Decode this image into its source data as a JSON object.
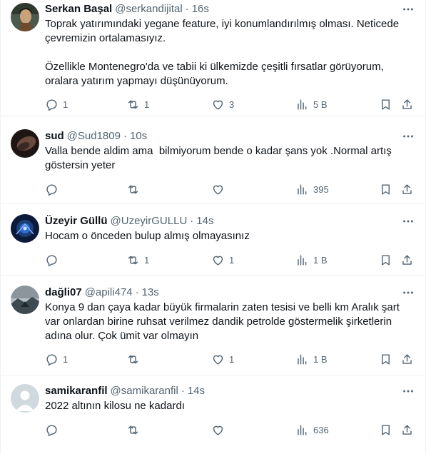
{
  "tweets": [
    {
      "name": "Serkan Başal",
      "handle": "@serkandijital",
      "time": "16s",
      "text": "Toprak yatırımındaki yegane feature, iyi konumlandırılmış olması. Neticede\nçevremizin ortalamasıyız.\n\nÖzellikle Montenegro'da ve tabii ki ülkemizde çeşitli fırsatlar görüyorum,\noralara yatırım yapmayı düşünüyorum.",
      "replies": "1",
      "reposts": "1",
      "likes": "3",
      "views": "5 B",
      "avatar_colors": [
        "#3a4a3c",
        "#c9a27a"
      ]
    },
    {
      "name": "sud",
      "handle": "@Sud1809",
      "time": "10s",
      "text": "Valla bende aldim ama  bilmiyorum bende o kadar şans yok .Normal artış\ngöstersin yeter",
      "replies": "",
      "reposts": "",
      "likes": "",
      "views": "395",
      "avatar_colors": [
        "#1d1614",
        "#6b4a40"
      ]
    },
    {
      "name": "Üzeyir Güllü",
      "handle": "@UzeyirGULLU",
      "time": "14s",
      "text": "Hocam o önceden bulup almış olmayasınız",
      "replies": "",
      "reposts": "1",
      "likes": "1",
      "views": "1 B",
      "avatar_colors": [
        "#0c1a3a",
        "#2d6fd0"
      ]
    },
    {
      "name": "dağli07",
      "handle": "@apili474",
      "time": "13s",
      "text": "Konya 9 dan çaya kadar büyük firmalarin zaten tesisi ve belli km Aralık şart\nvar onlardan birine ruhsat verilmez dandik petrolde göstermelik şirketlerin\nadına olur. Çok ümit var olmayın",
      "replies": "1",
      "reposts": "",
      "likes": "1",
      "views": "1 B",
      "avatar_colors": [
        "#8c959c",
        "#3d4a52"
      ]
    },
    {
      "name": "samikaranfil",
      "handle": "@samikaranfil",
      "time": "14s",
      "text": "2022 altının kilosu ne kadardı",
      "replies": "",
      "reposts": "",
      "likes": "",
      "views": "636",
      "avatar_colors": [
        "#cfd9de",
        "#ffffff"
      ]
    }
  ],
  "separator": "·",
  "icons": {
    "more": "more-horizontal-icon",
    "reply": "reply-icon",
    "repost": "repost-icon",
    "like": "heart-icon",
    "views": "views-chart-icon",
    "bookmark": "bookmark-icon",
    "share": "share-icon"
  },
  "colors": {
    "text_primary": "#0f1419",
    "text_secondary": "#536471",
    "divider": "#eff3f4"
  }
}
